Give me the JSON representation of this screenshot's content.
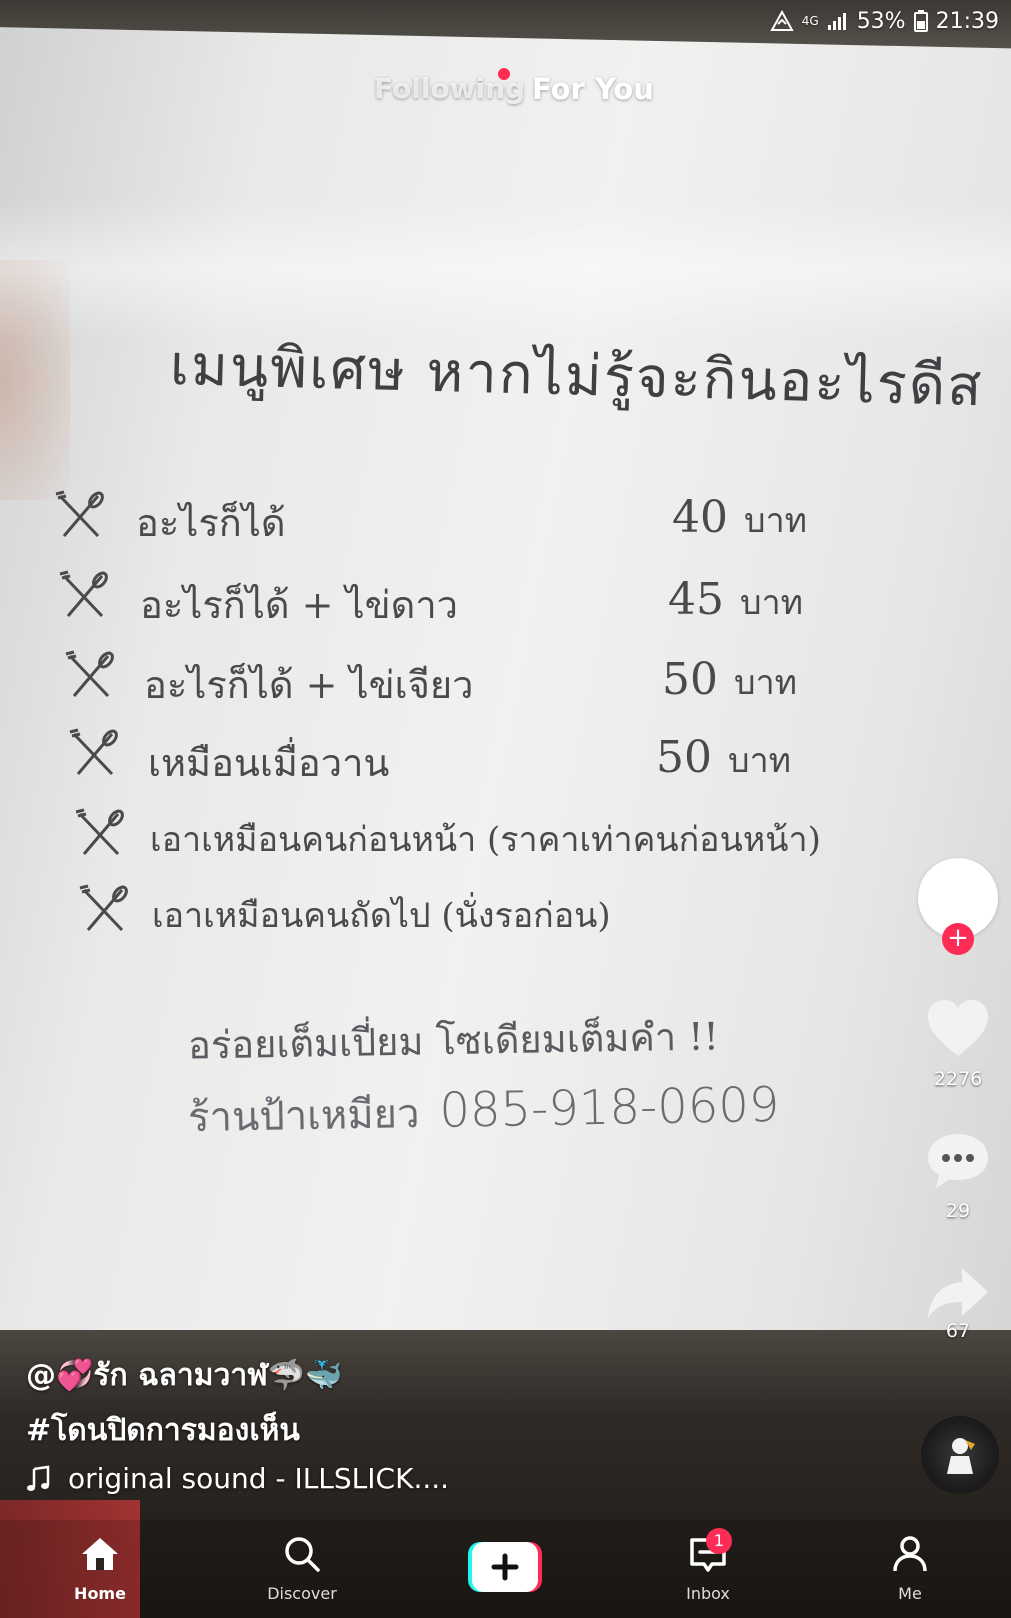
{
  "status_bar": {
    "network": "4G",
    "battery": "53%",
    "time": "21:39"
  },
  "top_tabs": {
    "following": "Following",
    "for_you": "For You",
    "active": "For You"
  },
  "menu_sign": {
    "title": "เมนูพิเศษ หากไม่รู้จะกินอะไรดีส",
    "items": [
      {
        "name": "อะไรก็ได้",
        "price": "40",
        "unit": "บาท"
      },
      {
        "name": "อะไรก็ได้ + ไข่ดาว",
        "price": "45",
        "unit": "บาท"
      },
      {
        "name": "อะไรก็ได้ + ไข่เจียว",
        "price": "50",
        "unit": "บาท"
      },
      {
        "name": "เหมือนเมื่อวาน",
        "price": "50",
        "unit": "บาท"
      },
      {
        "name": "เอาเหมือนคนก่อนหน้า (ราคาเท่าคนก่อนหน้า)",
        "price": "",
        "unit": ""
      },
      {
        "name": "เอาเหมือนคนถัดไป (นั่งรอก่อน)",
        "price": "",
        "unit": ""
      }
    ],
    "slogan": "อร่อยเต็มเปี่ยม โซเดียมเต็มคำ !!",
    "shop_name": "ร้านป้าเหมียว",
    "phone": "085-918-0609"
  },
  "actions": {
    "likes": "2276",
    "comments": "29",
    "shares": "67"
  },
  "caption": {
    "username": "@💞รัก ฉลามวาฬ🦈🐳",
    "hashtag": "#โดนปิดการมองเห็น"
  },
  "sound": {
    "icon": "music-note-icon",
    "label": "original sound - ILLSLICK...."
  },
  "bottom_nav": {
    "home": "Home",
    "discover": "Discover",
    "inbox": "Inbox",
    "inbox_badge": "1",
    "me": "Me"
  },
  "colors": {
    "accent": "#fe2c55",
    "create_cyan": "#25f4ee",
    "create_pink": "#fe2c55"
  }
}
